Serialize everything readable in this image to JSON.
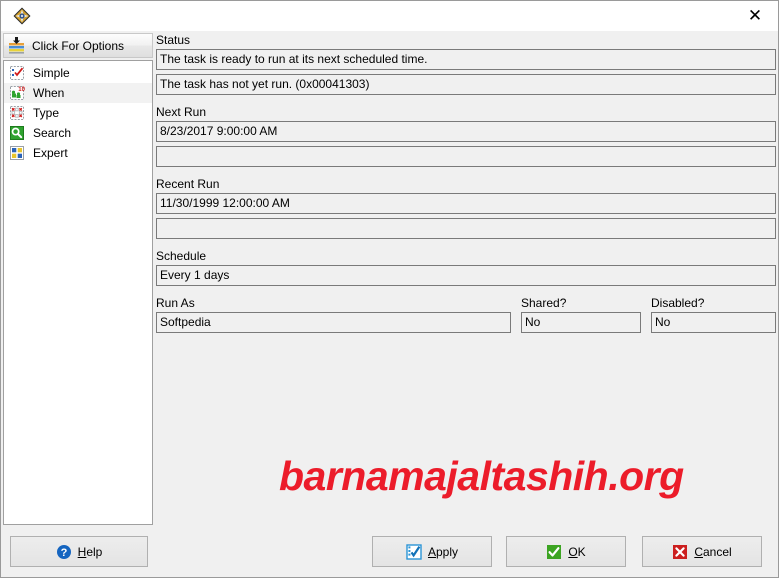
{
  "window": {
    "title": "",
    "app_icon": "diamond-compass-icon",
    "close_label": "✕"
  },
  "sidebar": {
    "header": {
      "label": "Click For Options",
      "icon": "options-list-icon"
    },
    "items": [
      {
        "label": "Simple",
        "icon": "simple-checklist-icon",
        "selected": false
      },
      {
        "label": "When",
        "icon": "when-calendar-icon",
        "selected": true
      },
      {
        "label": "Type",
        "icon": "type-grid-icon",
        "selected": false
      },
      {
        "label": "Search",
        "icon": "search-magnifier-icon",
        "selected": false
      },
      {
        "label": "Expert",
        "icon": "expert-grid-icon",
        "selected": false
      }
    ]
  },
  "main": {
    "status": {
      "label": "Status",
      "line1": "The task is ready to run at its next scheduled time.",
      "line2": "The task has not yet run.  (0x00041303)"
    },
    "next_run": {
      "label": "Next Run",
      "line1": "8/23/2017 9:00:00 AM",
      "line2": ""
    },
    "recent_run": {
      "label": "Recent Run",
      "line1": "11/30/1999 12:00:00 AM",
      "line2": ""
    },
    "schedule": {
      "label": "Schedule",
      "value": "Every 1 days"
    },
    "run_as": {
      "label": "Run As",
      "value": "Softpedia"
    },
    "shared": {
      "label": "Shared?",
      "value": "No"
    },
    "disabled": {
      "label": "Disabled?",
      "value": "No"
    }
  },
  "watermark": {
    "text": "barnamajaltashih.org",
    "color": "#ec1c2a"
  },
  "buttons": {
    "help": {
      "label": "Help",
      "accel": "H",
      "icon": "help-question-icon"
    },
    "apply": {
      "label": "Apply",
      "accel": "A",
      "icon": "apply-check-icon"
    },
    "ok": {
      "label": "OK",
      "accel": "O",
      "icon": "ok-check-icon"
    },
    "cancel": {
      "label": "Cancel",
      "accel": "C",
      "icon": "cancel-x-icon"
    }
  },
  "colors": {
    "window_bg": "#f0f0f0",
    "field_bg": "#f0f0f0",
    "field_border": "#7a7a7a",
    "list_bg": "#ffffff",
    "accent_red": "#ec1c2a",
    "accent_green": "#3ca422",
    "accent_blue": "#1e90d2"
  }
}
